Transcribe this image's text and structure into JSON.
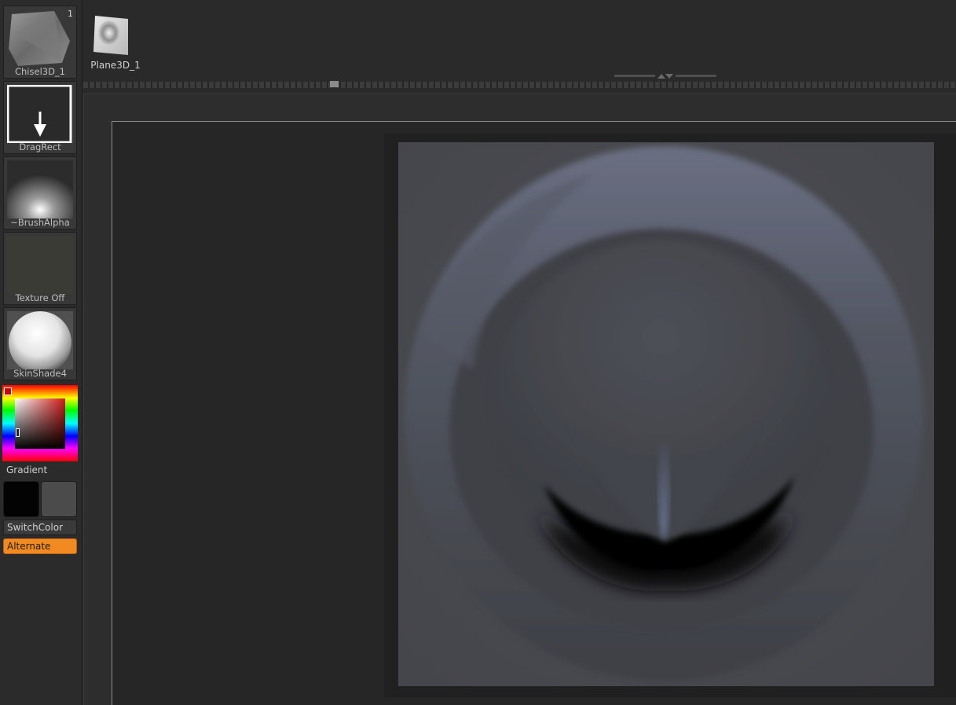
{
  "tools": {
    "current_tool": {
      "label": "Chisel3D_1",
      "count": "1"
    },
    "brush": {
      "label": "DragRect"
    },
    "alpha": {
      "label": "~BrushAlpha"
    },
    "texture": {
      "label": "Texture Off"
    },
    "material": {
      "label": "SkinShade4"
    }
  },
  "color": {
    "gradient_label": "Gradient",
    "main_color": "#030303",
    "secondary_color": "#4b4b4b",
    "switch_label": "SwitchColor",
    "alternate_label": "Alternate",
    "accent": "#f28a22"
  },
  "subtools": [
    {
      "label": "Plane3D_1"
    }
  ]
}
